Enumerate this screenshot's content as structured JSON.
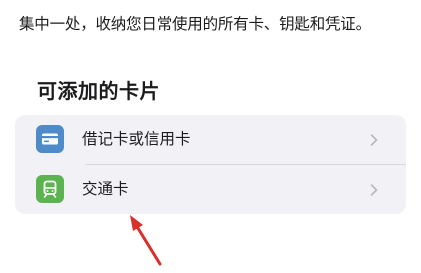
{
  "intro_text": "集中一处，收纳您日常使用的所有卡、钥匙和凭证。",
  "section_title": "可添加的卡片",
  "cards": [
    {
      "label": "借记卡或信用卡",
      "icon": "credit-card-icon",
      "icon_color": "#4f8bc9"
    },
    {
      "label": "交通卡",
      "icon": "train-icon",
      "icon_color": "#5cb450"
    }
  ],
  "colors": {
    "group_background": "#f2f2f6",
    "annotation_arrow": "#d9302c"
  }
}
